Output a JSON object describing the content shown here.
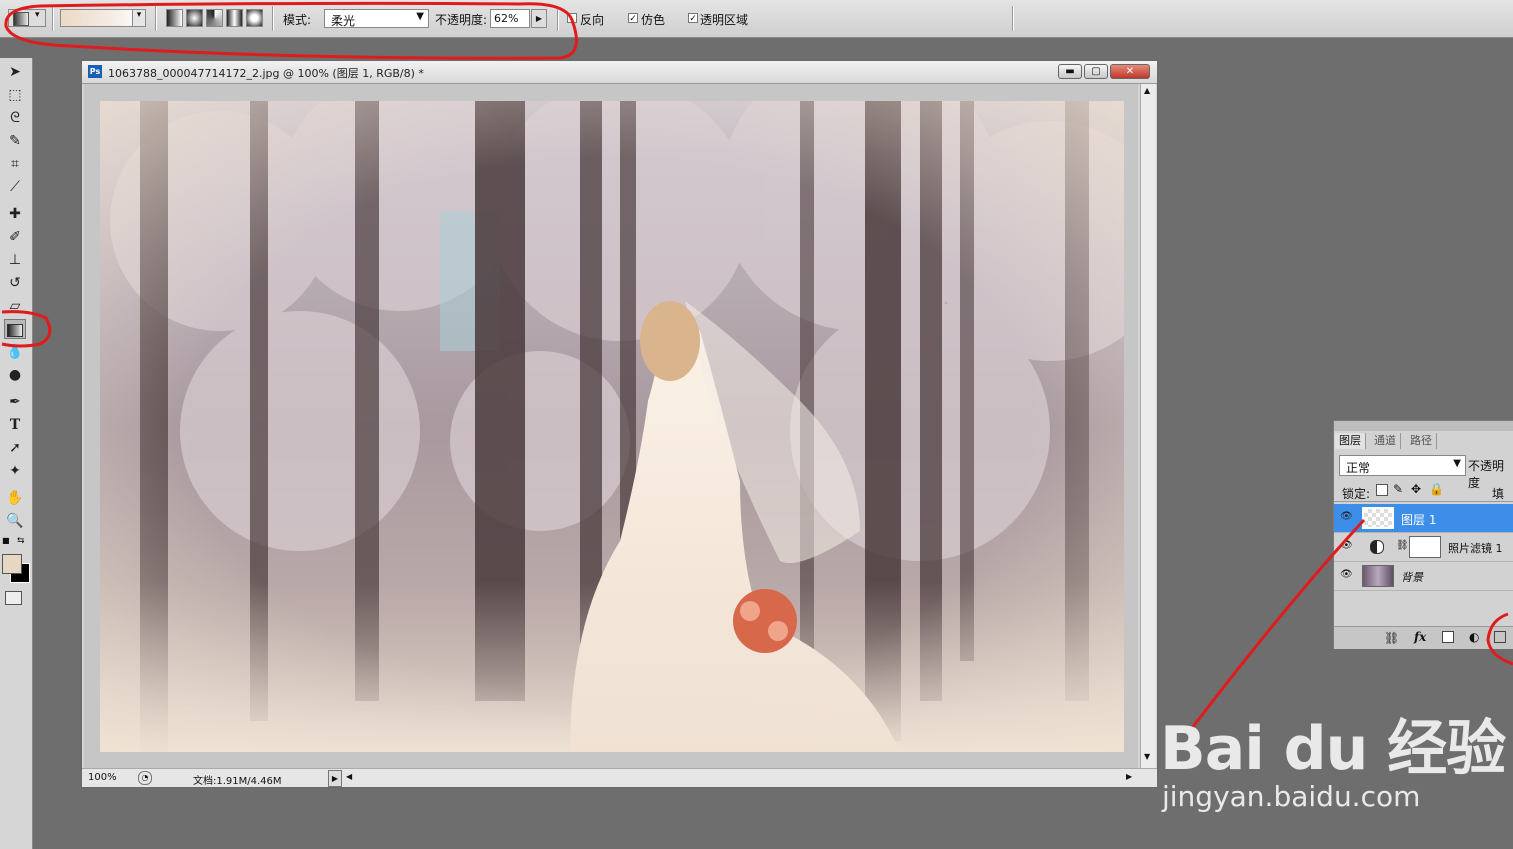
{
  "options_bar": {
    "mode_label": "模式:",
    "mode_value": "柔光",
    "opacity_label": "不透明度:",
    "opacity_value": "62%",
    "reverse_label": "反向",
    "dither_label": "仿色",
    "dither_checked": true,
    "transparency_label": "透明区域",
    "transparency_checked": true
  },
  "document": {
    "title": "1063788_000047714172_2.jpg @ 100% (图层 1, RGB/8) *",
    "app_icon": "Ps",
    "zoom": "100%",
    "doc_info": "文档:1.91M/4.46M"
  },
  "layers_panel": {
    "tabs": [
      "图层",
      "通道",
      "路径"
    ],
    "blend_mode": "正常",
    "opacity_label": "不透明度",
    "lock_label": "锁定:",
    "fill_label": "填充",
    "layers": [
      {
        "name": "图层 1",
        "selected": true,
        "visible": true
      },
      {
        "name": "照片滤镜 1",
        "selected": false,
        "visible": true
      },
      {
        "name": "背景",
        "selected": false,
        "visible": true
      }
    ],
    "footer_icons": [
      "link-icon",
      "fx-icon",
      "mask-icon",
      "adjustment-icon",
      "new-layer-icon"
    ]
  },
  "tools": [
    "move-icon",
    "marquee-icon",
    "lasso-icon",
    "quick-select-icon",
    "crop-icon",
    "eyedropper-icon",
    "healing-icon",
    "brush-icon",
    "stamp-icon",
    "history-brush-icon",
    "eraser-icon",
    "gradient-icon",
    "blur-icon",
    "dodge-icon",
    "pen-icon",
    "type-icon",
    "path-select-icon",
    "shape-icon",
    "hand-icon",
    "zoom-icon"
  ],
  "colors": {
    "selection_blue": "#3d8ee8",
    "annotation_red": "#e01b1b",
    "foreground": "#e8d6c4",
    "background": "#000000"
  },
  "watermark": {
    "logo": "Bai du 经验",
    "url": "jingyan.baidu.com"
  }
}
